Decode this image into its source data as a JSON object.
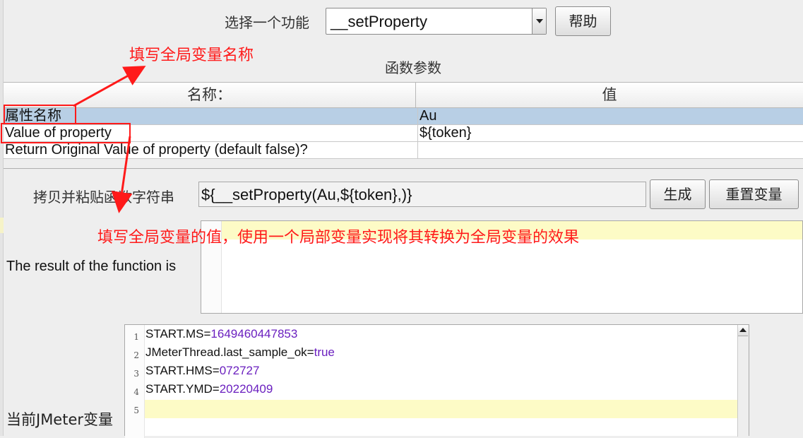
{
  "function_selector": {
    "label": "选择一个功能",
    "selected": "__setProperty",
    "help_button": "帮助"
  },
  "params": {
    "title": "函数参数",
    "columns": [
      "名称：",
      "值"
    ],
    "rows": [
      {
        "name": "属性名称",
        "value": "Au",
        "selected": true
      },
      {
        "name": "Value of property",
        "value": "${token}",
        "selected": false
      },
      {
        "name": "Return Original Value of property (default false)?",
        "value": "",
        "selected": false
      }
    ]
  },
  "copy_paste": {
    "label": "拷贝并粘贴函数字符串",
    "value": "${__setProperty(Au,${token},)}",
    "generate_button": "生成",
    "reset_button": "重置变量"
  },
  "result": {
    "label": "The result of the function is",
    "value": ""
  },
  "variables": {
    "label": "当前JMeter变量",
    "lines": [
      {
        "num": "1",
        "key": "START.MS=",
        "value": "1649460447853"
      },
      {
        "num": "2",
        "key": "JMeterThread.last_sample_ok=",
        "value": "true"
      },
      {
        "num": "3",
        "key": "START.HMS=",
        "value": "072727"
      },
      {
        "num": "4",
        "key": "START.YMD=",
        "value": "20220409"
      },
      {
        "num": "5",
        "key": "",
        "value": ""
      }
    ]
  },
  "annotations": {
    "note1": "填写全局变量名称",
    "note2": "填写全局变量的值，使用一个局部变量实现将其转换为全局变量的效果",
    "color": "#ff1a1a"
  }
}
